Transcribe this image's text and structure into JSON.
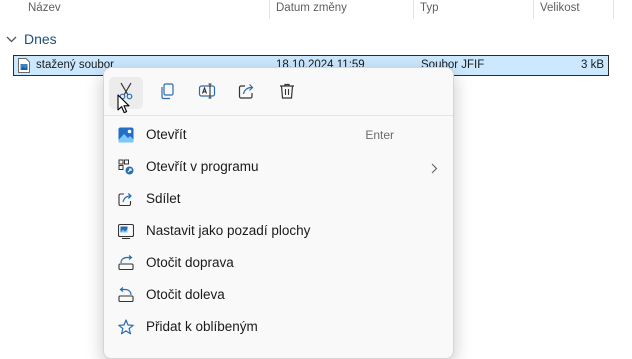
{
  "columns": [
    "Název",
    "Datum změny",
    "Typ",
    "Velikost"
  ],
  "group": {
    "label": "Dnes"
  },
  "file": {
    "name": "stažený soubor",
    "date": "18.10.2024 11:59",
    "type": "Soubor JFIF",
    "size": "3 kB"
  },
  "quick_actions": [
    "cut-icon",
    "copy-icon",
    "rename-icon",
    "share-icon",
    "delete-icon"
  ],
  "menu": {
    "open": {
      "label": "Otevřít",
      "shortcut": "Enter"
    },
    "open_with": {
      "label": "Otevřít v programu"
    },
    "share": {
      "label": "Sdílet"
    },
    "set_wallpaper": {
      "label": "Nastavit jako pozadí plochy"
    },
    "rotate_right": {
      "label": "Otočit doprava"
    },
    "rotate_left": {
      "label": "Otočit doleva"
    },
    "favorites": {
      "label": "Přidat k oblíbeným"
    }
  },
  "colors": {
    "selection": "#cce8ff",
    "group_header": "#1e4f80",
    "icon_blue": "#2b6cb0"
  }
}
